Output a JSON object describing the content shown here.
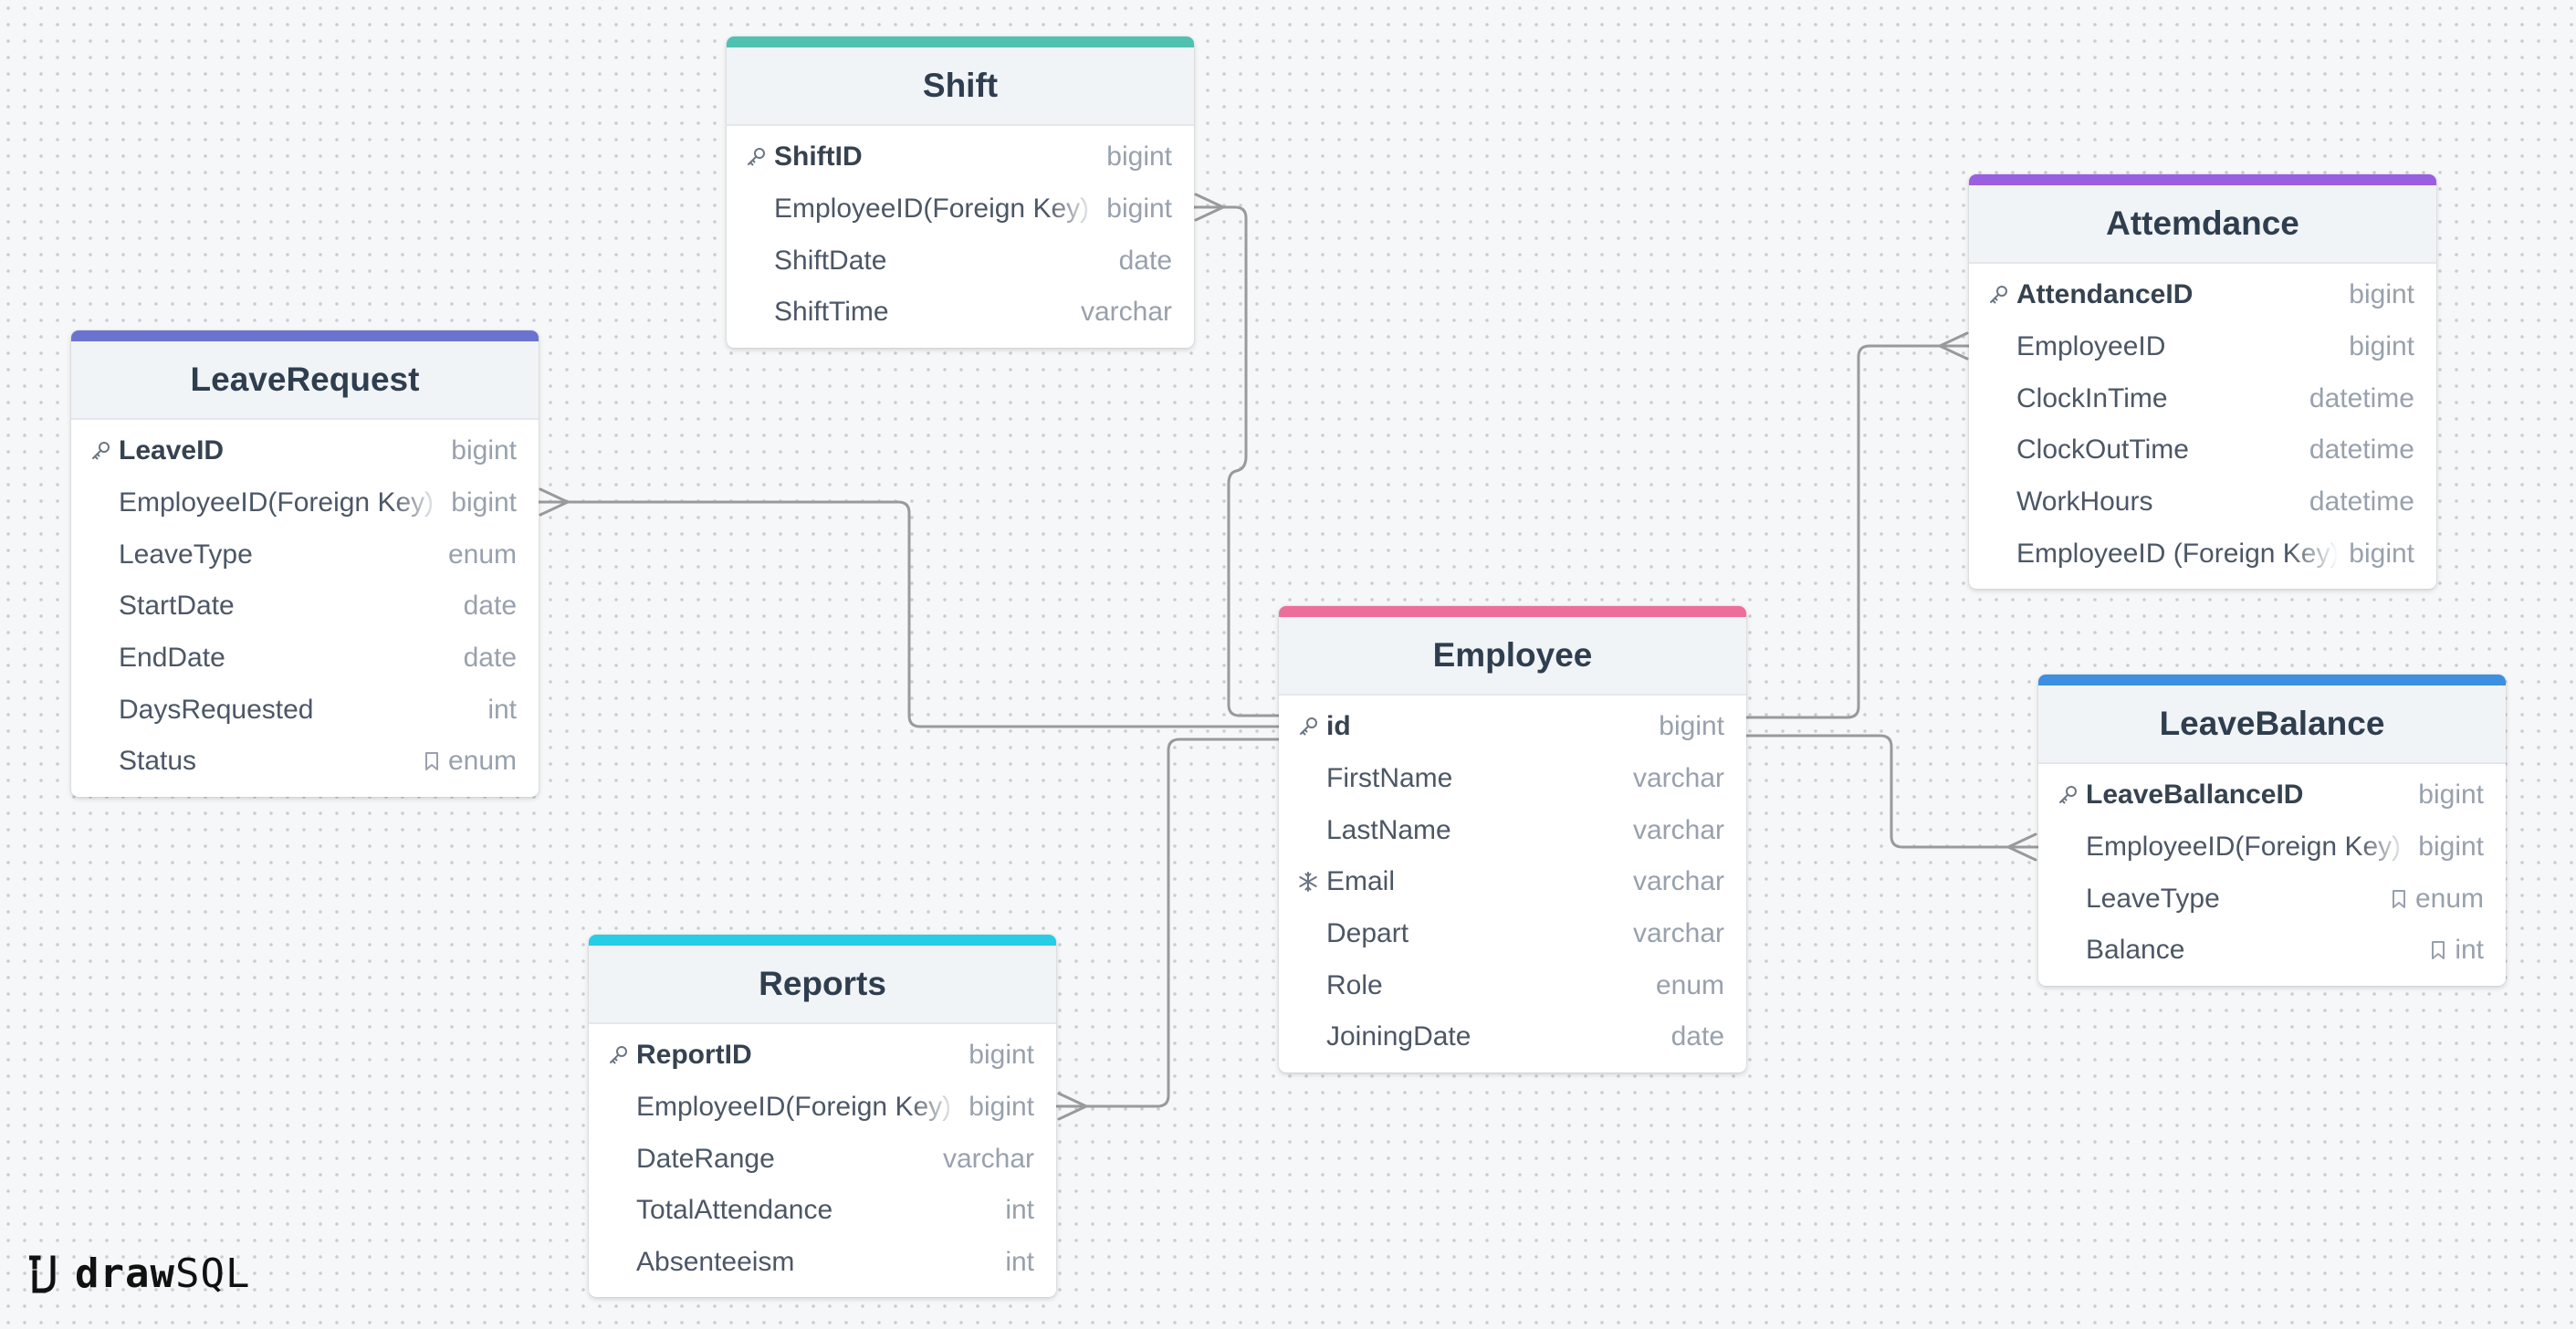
{
  "brand": {
    "bold": "draw",
    "light": "SQL"
  },
  "colors": {
    "connector": "#9a9a9a",
    "pk_icon": "#6b7684",
    "type_text": "#98a1ad"
  },
  "tables": {
    "shift": {
      "title": "Shift",
      "color": "#4fc1b0",
      "columns": [
        {
          "name": "ShiftID",
          "type": "bigint",
          "icon": "key-icon",
          "pk": true
        },
        {
          "name": "EmployeeID(Foreign Key)",
          "type": "bigint"
        },
        {
          "name": "ShiftDate",
          "type": "date"
        },
        {
          "name": "ShiftTime",
          "type": "varchar"
        }
      ]
    },
    "leave_request": {
      "title": "LeaveRequest",
      "color": "#6a74d0",
      "columns": [
        {
          "name": "LeaveID",
          "type": "bigint",
          "icon": "key-icon",
          "pk": true
        },
        {
          "name": "EmployeeID(Foreign Key)",
          "type": "bigint"
        },
        {
          "name": "LeaveType",
          "type": "enum"
        },
        {
          "name": "StartDate",
          "type": "date"
        },
        {
          "name": "EndDate",
          "type": "date"
        },
        {
          "name": "DaysRequested",
          "type": "int"
        },
        {
          "name": "Status",
          "type": "enum",
          "type_icon": "bookmark-icon"
        }
      ]
    },
    "attendance": {
      "title": "Attemdance",
      "color": "#9a5fe0",
      "columns": [
        {
          "name": "AttendanceID",
          "type": "bigint",
          "icon": "key-icon",
          "pk": true
        },
        {
          "name": "EmployeeID",
          "type": "bigint"
        },
        {
          "name": "ClockInTime",
          "type": "datetime"
        },
        {
          "name": "ClockOutTime",
          "type": "datetime"
        },
        {
          "name": "WorkHours",
          "type": "datetime"
        },
        {
          "name": "EmployeeID (Foreign Key)",
          "type": "bigint"
        }
      ]
    },
    "employee": {
      "title": "Employee",
      "color": "#ee6e9a",
      "columns": [
        {
          "name": "id",
          "type": "bigint",
          "icon": "key-icon",
          "pk": true
        },
        {
          "name": "FirstName",
          "type": "varchar"
        },
        {
          "name": "LastName",
          "type": "varchar"
        },
        {
          "name": "Email",
          "type": "varchar",
          "icon": "unique-icon"
        },
        {
          "name": "Depart",
          "type": "varchar"
        },
        {
          "name": "Role",
          "type": "enum"
        },
        {
          "name": "JoiningDate",
          "type": "date"
        }
      ]
    },
    "leave_balance": {
      "title": "LeaveBalance",
      "color": "#3d8fe0",
      "columns": [
        {
          "name": "LeaveBallanceID",
          "type": "bigint",
          "icon": "key-icon",
          "pk": true
        },
        {
          "name": "EmployeeID(Foreign Key)",
          "type": "bigint"
        },
        {
          "name": "LeaveType",
          "type": "enum",
          "type_icon": "bookmark-icon"
        },
        {
          "name": "Balance",
          "type": "int",
          "type_icon": "bookmark-icon"
        }
      ]
    },
    "reports": {
      "title": "Reports",
      "color": "#25cde6",
      "columns": [
        {
          "name": "ReportID",
          "type": "bigint",
          "icon": "key-icon",
          "pk": true
        },
        {
          "name": "EmployeeID(Foreign Key)",
          "type": "bigint"
        },
        {
          "name": "DateRange",
          "type": "varchar"
        },
        {
          "name": "TotalAttendance",
          "type": "int"
        },
        {
          "name": "Absenteeism",
          "type": "int"
        }
      ]
    }
  },
  "relationships": [
    {
      "from": "employee.id",
      "to": "shift.EmployeeID(Foreign Key)",
      "cardinality": "one-to-many"
    },
    {
      "from": "employee.id",
      "to": "leave_request.EmployeeID(Foreign Key)",
      "cardinality": "one-to-many"
    },
    {
      "from": "employee.id",
      "to": "attendance.EmployeeID",
      "cardinality": "one-to-many"
    },
    {
      "from": "employee.id",
      "to": "leave_balance.EmployeeID(Foreign Key)",
      "cardinality": "one-to-many"
    },
    {
      "from": "employee.id",
      "to": "reports.EmployeeID(Foreign Key)",
      "cardinality": "one-to-many"
    }
  ]
}
